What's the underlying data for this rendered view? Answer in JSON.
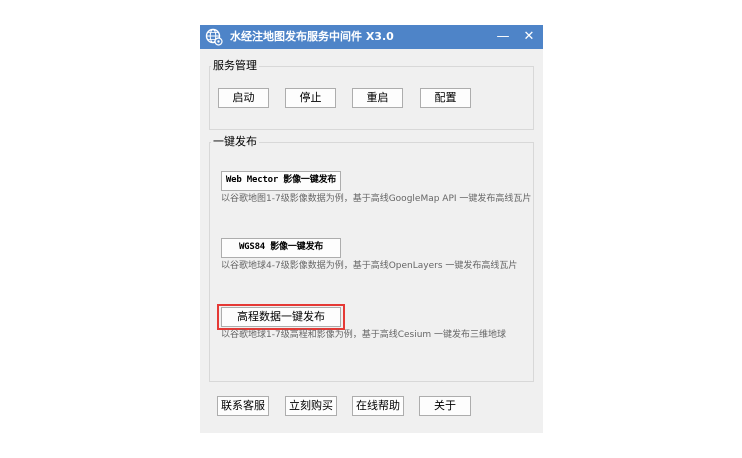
{
  "window": {
    "title": "水经注地图发布服务中间件 X3.0",
    "minimize_glyph": "—",
    "close_glyph": "✕"
  },
  "service_management": {
    "label": "服务管理",
    "buttons": [
      "启动",
      "停止",
      "重启",
      "配置"
    ]
  },
  "one_click_publish": {
    "label": "一键发布",
    "items": [
      {
        "button": "Web Mector 影像一键发布",
        "description": "以谷歌地图1-7级影像数据为例，基于高线GoogleMap API 一键发布高线瓦片"
      },
      {
        "button": "WGS84 影像一键发布",
        "description": "以谷歌地球4-7级影像数据为例，基于高线OpenLayers 一键发布高线瓦片"
      },
      {
        "button": "高程数据一键发布",
        "description": "以谷歌地球1-7级高程和影像为例，基于高线Cesium 一键发布三维地球",
        "highlighted": true
      }
    ]
  },
  "footer_buttons": [
    "联系客服",
    "立刻购买",
    "在线帮助",
    "关于"
  ],
  "colors": {
    "titlebar": "#4e84c8",
    "window_bg": "#f0f0f0",
    "highlight": "#e53935"
  }
}
